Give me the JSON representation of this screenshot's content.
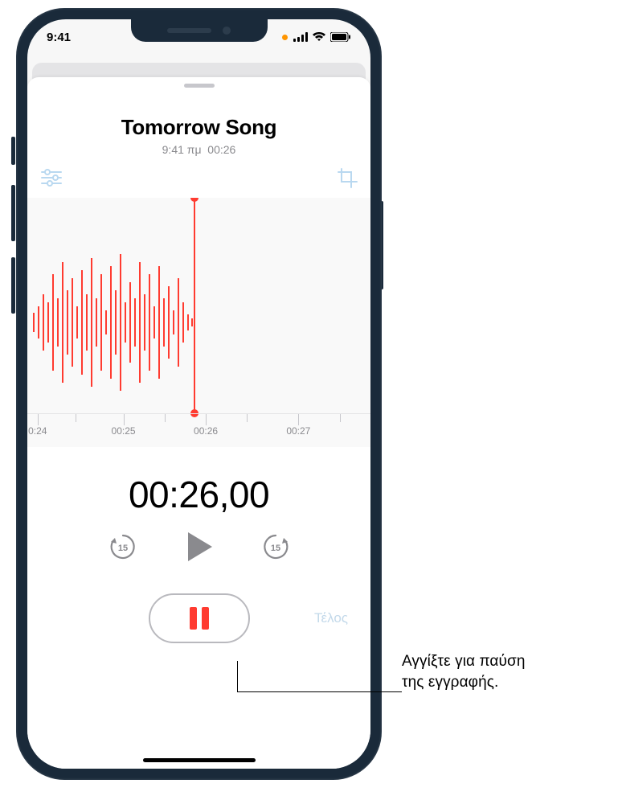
{
  "status_bar": {
    "time": "9:41",
    "recording_indicator": true
  },
  "recording": {
    "title": "Tomorrow Song",
    "subtitle_time": "9:41 πμ",
    "subtitle_duration": "00:26"
  },
  "timeline": {
    "ticks": [
      "0:24",
      "00:25",
      "00:26",
      "00:27"
    ]
  },
  "timer": "00:26,00",
  "playback": {
    "skip_back_seconds": "15",
    "skip_forward_seconds": "15"
  },
  "done_label": "Τέλος",
  "callout": {
    "line1": "Αγγίξτε για παύση",
    "line2": "της εγγραφής."
  },
  "icons": {
    "settings": "settings-sliders-icon",
    "crop": "crop-icon",
    "play": "play-icon",
    "pause": "pause-icon",
    "skip_back": "skip-back-15-icon",
    "skip_forward": "skip-forward-15-icon"
  },
  "colors": {
    "accent_red": "#ff3b30",
    "disabled_blue": "#b9d8f0",
    "muted_gray": "#8a8a8e"
  }
}
